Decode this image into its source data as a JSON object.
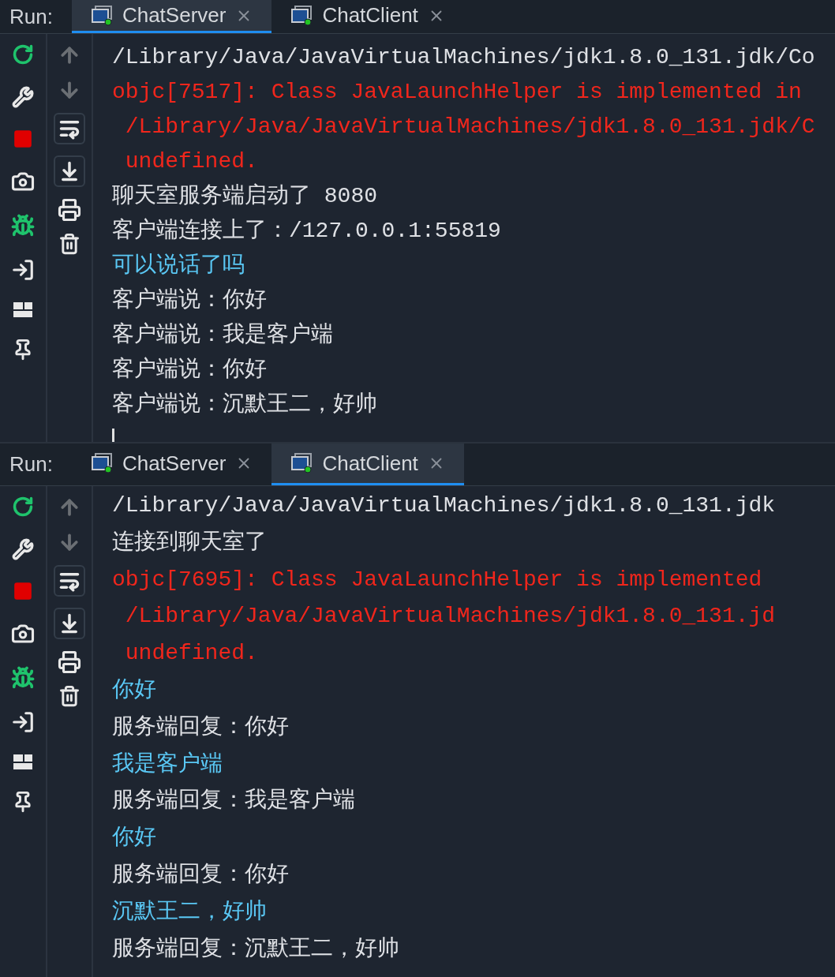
{
  "panels": [
    {
      "run_label": "Run:",
      "tabs": [
        {
          "label": "ChatServer",
          "selected": true
        },
        {
          "label": "ChatClient",
          "selected": false
        }
      ],
      "lines": [
        {
          "kind": "output",
          "text": "/Library/Java/JavaVirtualMachines/jdk1.8.0_131.jdk/Co"
        },
        {
          "kind": "error",
          "text": "objc[7517]: Class JavaLaunchHelper is implemented in"
        },
        {
          "kind": "error",
          "text": " /Library/Java/JavaVirtualMachines/jdk1.8.0_131.jdk/C"
        },
        {
          "kind": "error",
          "text": " undefined."
        },
        {
          "kind": "output",
          "text": "聊天室服务端启动了 8080"
        },
        {
          "kind": "output",
          "text": "客户端连接上了：/127.0.0.1:55819"
        },
        {
          "kind": "input",
          "text": "可以说话了吗"
        },
        {
          "kind": "output",
          "text": "客户端说：你好"
        },
        {
          "kind": "output",
          "text": "客户端说：我是客户端"
        },
        {
          "kind": "output",
          "text": "客户端说：你好"
        },
        {
          "kind": "output",
          "text": "客户端说：沉默王二，好帅"
        }
      ],
      "cursor": true
    },
    {
      "run_label": "Run:",
      "tabs": [
        {
          "label": "ChatServer",
          "selected": false
        },
        {
          "label": "ChatClient",
          "selected": true
        }
      ],
      "lines": [
        {
          "kind": "output",
          "text": "/Library/Java/JavaVirtualMachines/jdk1.8.0_131.jdk"
        },
        {
          "kind": "output",
          "text": "连接到聊天室了"
        },
        {
          "kind": "error",
          "text": "objc[7695]: Class JavaLaunchHelper is implemented"
        },
        {
          "kind": "error",
          "text": " /Library/Java/JavaVirtualMachines/jdk1.8.0_131.jd"
        },
        {
          "kind": "error",
          "text": " undefined."
        },
        {
          "kind": "input",
          "text": "你好"
        },
        {
          "kind": "output",
          "text": "服务端回复：你好"
        },
        {
          "kind": "input",
          "text": "我是客户端"
        },
        {
          "kind": "output",
          "text": "服务端回复：我是客户端"
        },
        {
          "kind": "input",
          "text": "你好"
        },
        {
          "kind": "output",
          "text": "服务端回复：你好"
        },
        {
          "kind": "input",
          "text": "沉默王二，好帅"
        },
        {
          "kind": "output",
          "text": "服务端回复：沉默王二，好帅"
        }
      ]
    }
  ]
}
